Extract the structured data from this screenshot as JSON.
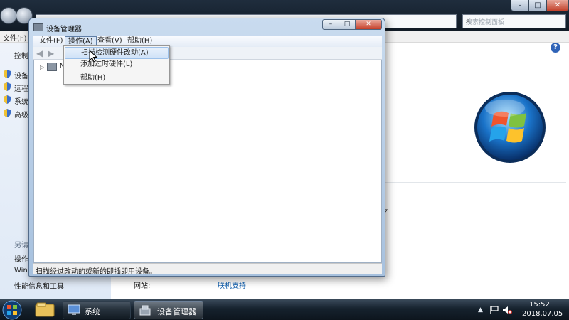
{
  "background_window": {
    "menu_file": "文件(F)",
    "search_placeholder": "搜索控制面板",
    "sidebar_items": [
      "控制面",
      "设备管",
      "远程设",
      "系统保",
      "高级系"
    ],
    "see_also_heading": "另请参",
    "see_also": [
      "操作中",
      "Windo",
      "性能信息和工具"
    ],
    "hz_fragment": "z",
    "website_label": "网站:",
    "website_link": "联机支持",
    "help_icon": "?"
  },
  "device_manager": {
    "title": "设备管理器",
    "caption": {
      "min": "–",
      "max": "□",
      "close": "✕"
    },
    "menu": [
      "文件(F)",
      "操作(A)",
      "查看(V)",
      "帮助(H)"
    ],
    "active_menu": "操作(A)",
    "tree_root_label": "NS",
    "dropdown": {
      "items": [
        "扫描检测硬件改动(A)",
        "添加过时硬件(L)",
        "帮助(H)"
      ],
      "highlighted": "扫描检测硬件改动(A)"
    },
    "status_text": "扫描经过改动的或新的即插即用设备。"
  },
  "taskbar": {
    "items": [
      {
        "label": "系统",
        "icon": "system-icon"
      },
      {
        "label": "设备管理器",
        "icon": "device-manager-icon",
        "active": true
      }
    ],
    "clock_time": "15:52",
    "clock_date": "2018.07.05"
  },
  "colors": {
    "taskbar": "#16222e",
    "dialog_frame": "#a7c1de",
    "menu_highlight": "#cfe2f7",
    "link": "#0b5cad",
    "close_button": "#c5402a"
  }
}
